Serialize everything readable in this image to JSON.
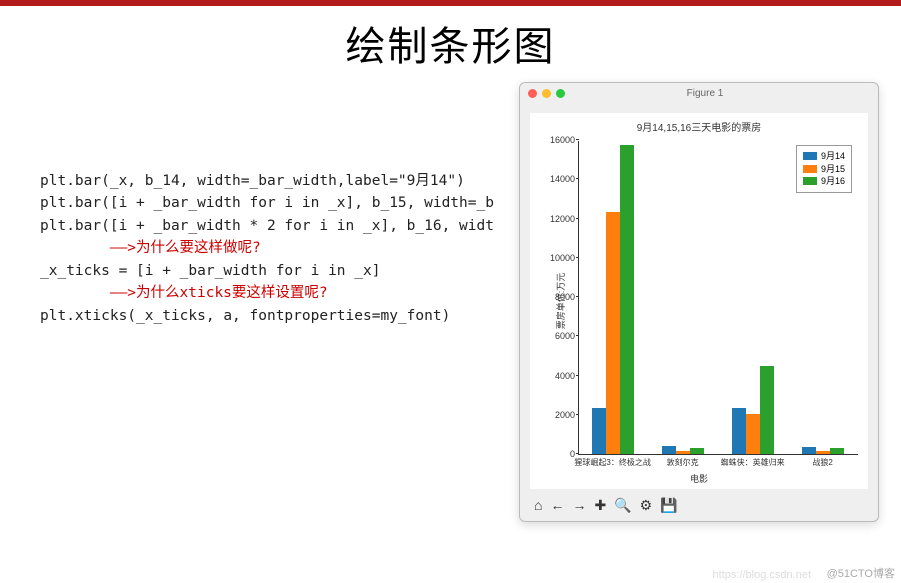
{
  "title": "绘制条形图",
  "code": {
    "l1": "plt.bar(_x, b_14, width=_bar_width,label=\"9月14\")",
    "l2": "plt.bar([i + _bar_width for i in _x], b_15, width=_b",
    "l3": "plt.bar([i + _bar_width * 2 for i in _x], b_16, widt",
    "l4": "        ——>为什么要这样做呢?",
    "l5": "_x_ticks = [i + _bar_width for i in _x]",
    "l6": "        ——>为什么xticks要这样设置呢?",
    "l7": "plt.xticks(_x_ticks, a, fontproperties=my_font)"
  },
  "figure": {
    "window_title": "Figure 1",
    "toolbar": [
      "⌂",
      "←",
      "→",
      "✚",
      "🔍",
      "⚙",
      "💾"
    ]
  },
  "chart_data": {
    "type": "bar",
    "title": "9月14,15,16三天电影的票房",
    "xlabel": "电影",
    "ylabel": "票房单位:万元",
    "ylim": [
      0,
      16000
    ],
    "yticks": [
      0,
      2000,
      4000,
      6000,
      8000,
      10000,
      12000,
      14000,
      16000
    ],
    "categories": [
      "猩球崛起3：终极之战",
      "敦刻尔克",
      "蜘蛛侠：英雄归来",
      "战狼2"
    ],
    "series": [
      {
        "name": "9月14",
        "color": "#1f77b4",
        "values": [
          2358,
          399,
          2358,
          362
        ]
      },
      {
        "name": "9月15",
        "color": "#ff7f0e",
        "values": [
          12357,
          156,
          2045,
          168
        ]
      },
      {
        "name": "9月16",
        "color": "#2ca02c",
        "values": [
          15746,
          312,
          4497,
          319
        ]
      }
    ]
  },
  "watermark": "@51CTO博客",
  "watermark_url": "https://blog.csdn.net"
}
